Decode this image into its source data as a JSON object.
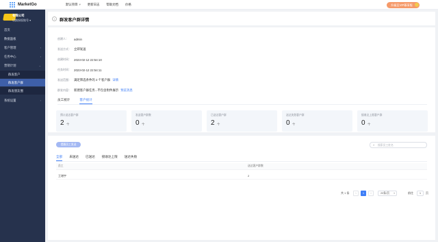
{
  "app": {
    "name": "MarketGo"
  },
  "topnav": [
    {
      "label": "默认项目",
      "caret": "▾"
    },
    {
      "label": "更新日志"
    },
    {
      "label": "帮助文档"
    },
    {
      "label": "价格"
    }
  ],
  "upgrade": {
    "label": "升级至VIP尊享版"
  },
  "user": {
    "initial": ""
  },
  "sidebar": {
    "company_name": "有限公司",
    "company_switch": "切换授权账号 ▾",
    "items": [
      {
        "label": "首页"
      },
      {
        "label": "数据面板"
      },
      {
        "label": "客户管理",
        "arrow": "›"
      },
      {
        "label": "任务中心",
        "arrow": "›"
      },
      {
        "label": "营销计划",
        "arrow": "⌄"
      },
      {
        "label": "群发客户"
      },
      {
        "label": "群发客户群"
      },
      {
        "label": "群发朋友圈"
      },
      {
        "label": "系统设置",
        "arrow": "›"
      }
    ]
  },
  "page": {
    "back": "‹",
    "title": "群发客户群详情"
  },
  "info": [
    {
      "label": "创建人：",
      "value": "admin"
    },
    {
      "label": "发送方式：",
      "value": "立即发送"
    },
    {
      "label": "创建时间：",
      "value": "2023-02-12 22:54:10"
    },
    {
      "label": "任务时间：",
      "value": "2023-02-12 22:54:11"
    },
    {
      "label": "发送范围：",
      "value": "满足筛选条件的 2 个客户群",
      "link": "详情"
    },
    {
      "label": "群发内容：",
      "value": "新建客户群任务...不包含附件展示",
      "link": "预览消息"
    }
  ],
  "tabs": [
    {
      "label": "员工统计"
    },
    {
      "label": "客户统计"
    }
  ],
  "stats": [
    {
      "label": "预计送达客户群",
      "value": "2",
      "unit": "个"
    },
    {
      "label": "发送客户群数",
      "value": "0",
      "unit": "个"
    },
    {
      "label": "已送达客户群",
      "value": "2",
      "unit": "个"
    },
    {
      "label": "送达失败客户群",
      "value": "0",
      "unit": "个"
    },
    {
      "label": "接收达上限客户群",
      "value": "0",
      "unit": "个"
    }
  ],
  "list": {
    "add_label": "提醒员工发送",
    "search_placeholder": "搜索员工姓名",
    "filter_tabs": [
      {
        "label": "全部"
      },
      {
        "label": "未送达"
      },
      {
        "label": "已送达"
      },
      {
        "label": "接收达上限"
      },
      {
        "label": "送达失败"
      }
    ],
    "columns": [
      "员工",
      "送达客户群数"
    ],
    "rows": [
      {
        "name": "王增宇",
        "count": "2"
      }
    ]
  },
  "pagination": {
    "total": "共 1 条",
    "prev": "‹",
    "page": "1",
    "next": "›",
    "size": "20条/页",
    "size_caret": "▾",
    "goto_label": "前往",
    "goto_value": "1",
    "page_suffix": "页"
  }
}
